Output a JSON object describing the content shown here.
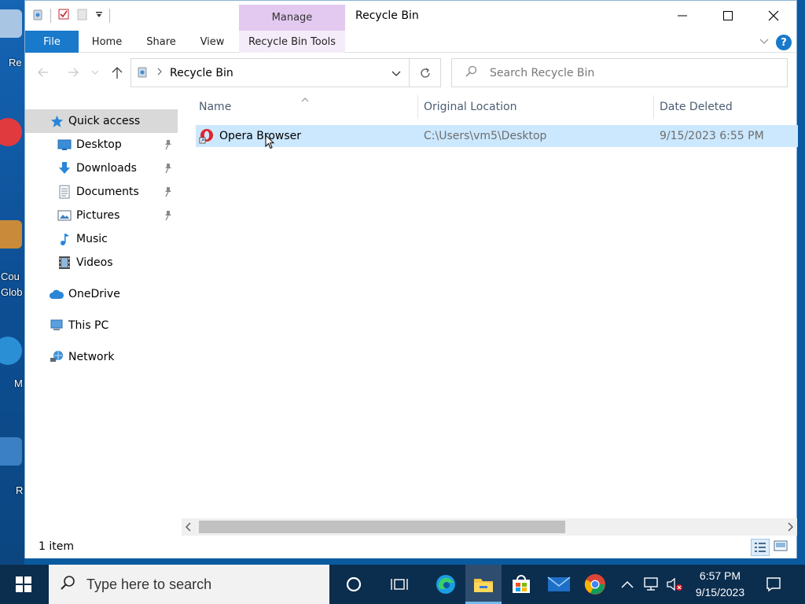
{
  "desktop": {
    "labels": [
      "Re",
      "Cou",
      "Glob",
      "M",
      "R"
    ]
  },
  "window": {
    "title": "Recycle Bin",
    "context_tab": "Manage",
    "controls": {
      "minimize": "minimize-icon",
      "maximize": "maximize-icon",
      "close": "close-icon"
    }
  },
  "ribbon": {
    "tabs": [
      "File",
      "Home",
      "Share",
      "View",
      "Recycle Bin Tools"
    ],
    "help": "?"
  },
  "address": {
    "path": "Recycle Bin",
    "search_placeholder": "Search Recycle Bin"
  },
  "nav": {
    "quick_access": "Quick access",
    "items": [
      {
        "label": "Desktop",
        "pinned": true
      },
      {
        "label": "Downloads",
        "pinned": true
      },
      {
        "label": "Documents",
        "pinned": true
      },
      {
        "label": "Pictures",
        "pinned": true
      },
      {
        "label": "Music",
        "pinned": false
      },
      {
        "label": "Videos",
        "pinned": false
      }
    ],
    "onedrive": "OneDrive",
    "this_pc": "This PC",
    "network": "Network"
  },
  "columns": {
    "name": "Name",
    "original_location": "Original Location",
    "date_deleted": "Date Deleted"
  },
  "rows": [
    {
      "name": "Opera Browser",
      "location": "C:\\Users\\vm5\\Desktop",
      "date": "9/15/2023 6:55 PM"
    }
  ],
  "status": {
    "count": "1 item"
  },
  "taskbar": {
    "search_placeholder": "Type here to search",
    "time": "6:57 PM",
    "date": "9/15/2023"
  },
  "colors": {
    "accent": "#1979ca",
    "selection": "#cce8ff",
    "manage_tab": "#e3c9f0",
    "taskbar": "#0b2d4e"
  }
}
